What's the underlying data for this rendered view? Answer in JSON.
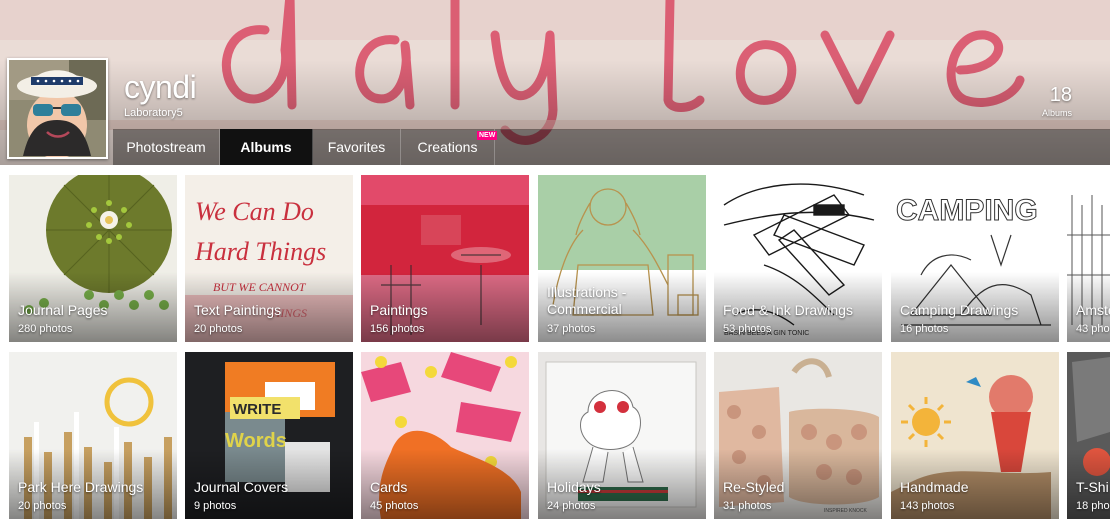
{
  "profile": {
    "username": "cyndi",
    "realname": "Laboratory5",
    "albums_count": "18",
    "albums_label": "Albums"
  },
  "nav": {
    "tabs": [
      {
        "label": "Photostream",
        "active": false
      },
      {
        "label": "Albums",
        "active": true
      },
      {
        "label": "Favorites",
        "active": false
      },
      {
        "label": "Creations",
        "active": false,
        "badge": "NEW"
      }
    ]
  },
  "albums": [
    {
      "title": "Journal Pages",
      "count": "280 photos"
    },
    {
      "title": "Text Paintings",
      "count": "20 photos"
    },
    {
      "title": "Paintings",
      "count": "156 photos"
    },
    {
      "title": "Illustrations - Commercial",
      "count": "37 photos"
    },
    {
      "title": "Food & Ink Drawings",
      "count": "53 photos"
    },
    {
      "title": "Camping Drawings",
      "count": "16 photos"
    },
    {
      "title": "Amste",
      "count": "43 pho"
    },
    {
      "title": "Park Here Drawings",
      "count": "20 photos"
    },
    {
      "title": "Journal Covers",
      "count": "9 photos"
    },
    {
      "title": "Cards",
      "count": "45 photos"
    },
    {
      "title": "Holidays",
      "count": "24 photos"
    },
    {
      "title": "Re-Styled",
      "count": "31 photos"
    },
    {
      "title": "Handmade",
      "count": "143 photos"
    },
    {
      "title": "T-Shi",
      "count": "18 pho"
    }
  ],
  "colors": {
    "accent_new": "#ff0084",
    "active_tab": "#111111"
  }
}
